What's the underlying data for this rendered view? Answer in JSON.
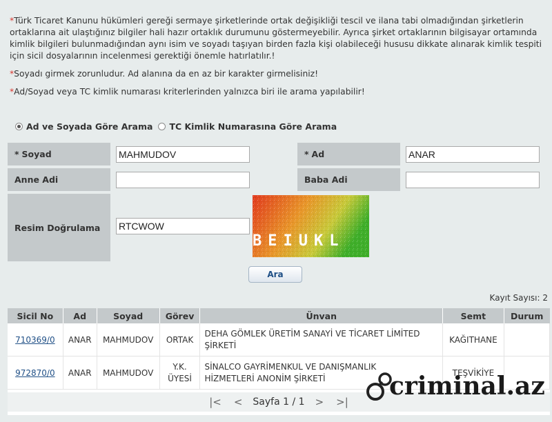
{
  "notices": {
    "n1": "Türk Ticaret Kanunu hükümleri gereği sermaye şirketlerinde ortak değişikliği tescil ve ilana tabi olmadığından şirketlerin ortaklarına ait ulaştığınız bilgiler hali hazır ortaklık durumunu göstermeyebilir. Ayrıca şirket ortaklarının bilgisayar ortamında kimlik bilgileri bulunmadığından aynı isim ve soyadı taşıyan birden fazla kişi olabileceği hususu dikkate alınarak kimlik tespiti için sicil dosyalarının incelenmesi gerektiği önemle hatırlatılır.!",
    "n2": "Soyadı girmek zorunludur. Ad alanına da en az bir karakter girmelisiniz!",
    "n3": "Ad/Soyad veya TC kimlik numarası kriterlerinden yalnızca biri ile arama yapılabilir!",
    "star": "*"
  },
  "search_mode": {
    "option1": "Ad ve Soyada Göre Arama",
    "option2": "TC Kimlik Numarasına Göre Arama",
    "selected": "option1"
  },
  "form": {
    "soyad_label": "Soyad",
    "soyad_value": "MAHMUDOV",
    "ad_label": "Ad",
    "ad_value": "ANAR",
    "anne_label": "Anne Adi",
    "anne_value": "",
    "baba_label": "Baba Adi",
    "baba_value": "",
    "captcha_label": "Resim Doğrulama",
    "captcha_value": "RTCWOW",
    "captcha_image_text": "BEIUKL",
    "required_mark": "*",
    "search_button": "Ara"
  },
  "results": {
    "count_label": "Kayıt Sayısı: 2",
    "columns": [
      "Sicil No",
      "Ad",
      "Soyad",
      "Görev",
      "Ünvan",
      "Semt",
      "Durum"
    ],
    "rows": [
      {
        "sicil": "710369/0",
        "ad": "ANAR",
        "soyad": "MAHMUDOV",
        "gorev": "ORTAK",
        "unvan_line1": "DEHA GÖMLEK ÜRETİM SANAYİ VE TİCARET LİMİTED",
        "unvan_line2": "ŞİRKETİ",
        "semt": "KAĞITHANE",
        "durum": ""
      },
      {
        "sicil": "972870/0",
        "ad": "ANAR",
        "soyad": "MAHMUDOV",
        "gorev_line1": "Y.K.",
        "gorev_line2": "ÜYESİ",
        "unvan_line1": "SİNALCO GAYRİMENKUL VE DANIŞMANLIK",
        "unvan_line2": "HİZMETLERİ ANONİM ŞİRKETİ",
        "semt": "TEŞVİKİYE",
        "durum": ""
      }
    ]
  },
  "pager": {
    "first": "|<",
    "prev": "<",
    "label": "Sayfa 1 / 1",
    "next": ">",
    "last": ">|"
  },
  "watermark": {
    "text": "criminal.az"
  },
  "colors": {
    "label_bg": "#c4c9cb",
    "page_bg": "#e7ecec",
    "link": "#1f4f86",
    "required": "#d8342c"
  }
}
